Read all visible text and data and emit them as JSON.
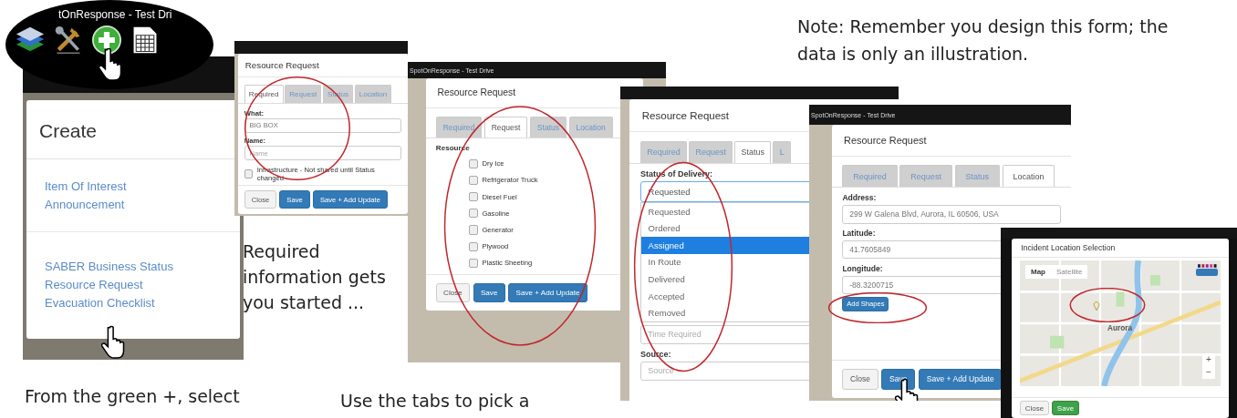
{
  "captions": [
    {
      "text": "Note: Remember you design this form; the data is only an illustration."
    },
    {
      "text": "Required information gets you started ..."
    },
    {
      "text": "From the green +, select"
    },
    {
      "text": "Use the tabs to pick a"
    }
  ],
  "create_panel": {
    "app_title": "tOnResponse - Test Dri",
    "menu_title": "Create",
    "groups": [
      [
        "Item Of Interest",
        "Announcement"
      ],
      [
        "SABER Business Status",
        "Resource Request",
        "Evacuation Checklist"
      ]
    ]
  },
  "dialogs": [
    {
      "title": "Resource Request",
      "tabs": [
        {
          "label": "Required",
          "selected": true
        },
        {
          "label": "Request",
          "selected": false
        },
        {
          "label": "Status",
          "selected": false
        },
        {
          "label": "Location",
          "selected": false
        }
      ],
      "rows": [
        {
          "kind": "field",
          "label": "What:",
          "value": "BIG BOX"
        },
        {
          "kind": "field",
          "label": "Name:",
          "placeholder": "Name"
        },
        {
          "kind": "check",
          "label": "Infrastructure - Not shared until Status changed",
          "checked": false
        }
      ],
      "buttons": [
        {
          "label": "Close",
          "kind": "default"
        },
        {
          "label": "Save",
          "kind": "primary"
        },
        {
          "label": "Save + Add Update",
          "kind": "primary"
        }
      ]
    },
    {
      "app_title": "SpotOnResponse - Test Drive",
      "title": "Resource Request",
      "tabs": [
        {
          "label": "Required",
          "selected": false
        },
        {
          "label": "Request",
          "selected": true
        },
        {
          "label": "Status",
          "selected": false
        },
        {
          "label": "Location",
          "selected": false
        }
      ],
      "rows": [
        {
          "kind": "heading",
          "text": "Resource"
        },
        {
          "kind": "check",
          "label": "Dry Ice",
          "checked": false
        },
        {
          "kind": "check",
          "label": "Refrigerator Truck",
          "checked": false
        },
        {
          "kind": "check",
          "label": "Diesel Fuel",
          "checked": false
        },
        {
          "kind": "check",
          "label": "Gasoline",
          "checked": false
        },
        {
          "kind": "check",
          "label": "Generator",
          "checked": false
        },
        {
          "kind": "check",
          "label": "Plywood",
          "checked": false
        },
        {
          "kind": "check",
          "label": "Plastic Sheeting",
          "checked": false
        }
      ],
      "buttons": [
        {
          "label": "Close",
          "kind": "default"
        },
        {
          "label": "Save",
          "kind": "primary"
        },
        {
          "label": "Save + Add Update",
          "kind": "primary"
        }
      ]
    },
    {
      "title": "Resource Request",
      "tabs": [
        {
          "label": "Required",
          "selected": false
        },
        {
          "label": "Request",
          "selected": false
        },
        {
          "label": "Status",
          "selected": true
        },
        {
          "label": "L",
          "selected": false
        }
      ],
      "rows": [
        {
          "kind": "heading",
          "text": "Status of Delivery:"
        },
        {
          "kind": "select",
          "value": "Requested"
        },
        {
          "kind": "options",
          "items": [
            {
              "label": "Requested",
              "selected": false
            },
            {
              "label": "Ordered",
              "selected": false
            },
            {
              "label": "Assigned",
              "selected": true
            },
            {
              "label": "In Route",
              "selected": false
            },
            {
              "label": "Delivered",
              "selected": false
            },
            {
              "label": "Accepted",
              "selected": false
            },
            {
              "label": "Removed",
              "selected": false
            }
          ]
        },
        {
          "kind": "field",
          "placeholder": "Time Required"
        },
        {
          "kind": "field",
          "label": "Source:",
          "placeholder": "Source"
        }
      ]
    },
    {
      "app_title": "SpotOnResponse - Test Drive",
      "title": "Resource Request",
      "tabs": [
        {
          "label": "Required",
          "selected": false
        },
        {
          "label": "Request",
          "selected": false
        },
        {
          "label": "Status",
          "selected": false
        },
        {
          "label": "Location",
          "selected": true
        }
      ],
      "rows": [
        {
          "kind": "field",
          "label": "Address:",
          "value": "299 W Galena Blvd, Aurora, IL 60506, USA"
        },
        {
          "kind": "field",
          "label": "Latitude:",
          "value": "41.7605849"
        },
        {
          "kind": "field",
          "label": "Longitude:",
          "value": "-88.3200715"
        },
        {
          "kind": "action",
          "label": "Add Shapes"
        }
      ],
      "buttons": [
        {
          "label": "Close",
          "kind": "default"
        },
        {
          "label": "Save",
          "kind": "primary"
        },
        {
          "label": "Save + Add Update",
          "kind": "primary"
        }
      ]
    },
    {
      "title": "Incident Location Selection",
      "rows": [
        {
          "kind": "map",
          "modes": [
            {
              "label": "Map",
              "selected": true
            },
            {
              "label": "Satellite",
              "selected": false
            }
          ],
          "place": "Aurora",
          "zoom": [
            "+",
            "−"
          ]
        }
      ],
      "buttons": [
        {
          "label": "Close",
          "kind": "default"
        },
        {
          "label": "Save",
          "kind": "success"
        }
      ]
    }
  ]
}
